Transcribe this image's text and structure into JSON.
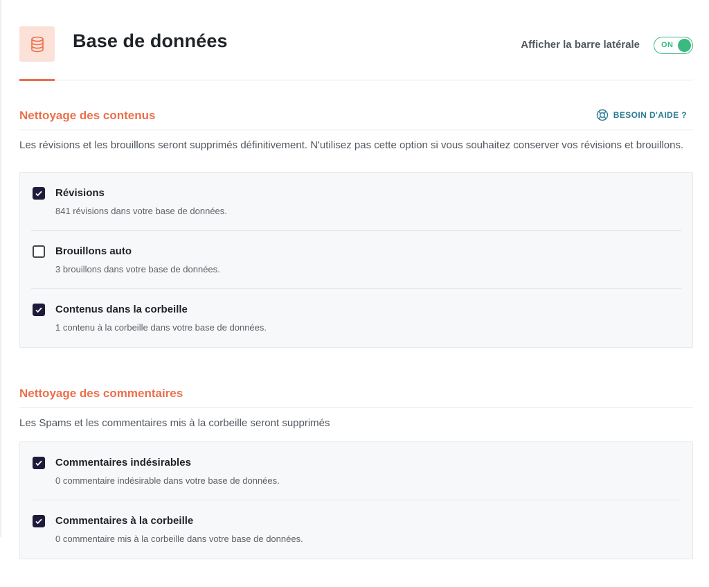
{
  "header": {
    "title": "Base de données",
    "icon": "database-icon",
    "sidebar_label": "Afficher la barre latérale",
    "toggle_label": "ON",
    "toggle_on": true
  },
  "colors": {
    "accent": "#ec6f4a",
    "toggle_green": "#3ab980",
    "checkbox": "#1e1b3a",
    "help": "#2b7d92"
  },
  "content_cleanup": {
    "title": "Nettoyage des contenus",
    "help_label": "BESOIN D'AIDE ?",
    "help_icon": "lifebuoy-icon",
    "description": "Les révisions et les brouillons seront supprimés définitivement. N'utilisez pas cette option si vous souhaitez conserver vos révisions et brouillons.",
    "options": [
      {
        "label": "Révisions",
        "detail": "841 révisions dans votre base de données.",
        "checked": true
      },
      {
        "label": "Brouillons auto",
        "detail": "3 brouillons dans votre base de données.",
        "checked": false
      },
      {
        "label": "Contenus dans la corbeille",
        "detail": "1 contenu à la corbeille dans votre base de données.",
        "checked": true
      }
    ]
  },
  "comment_cleanup": {
    "title": "Nettoyage des commentaires",
    "description": "Les Spams et les commentaires mis à la corbeille seront supprimés",
    "options": [
      {
        "label": "Commentaires indésirables",
        "detail": "0 commentaire indésirable dans votre base de données.",
        "checked": true
      },
      {
        "label": "Commentaires à la corbeille",
        "detail": "0 commentaire mis à la corbeille dans votre base de données.",
        "checked": true
      }
    ]
  }
}
